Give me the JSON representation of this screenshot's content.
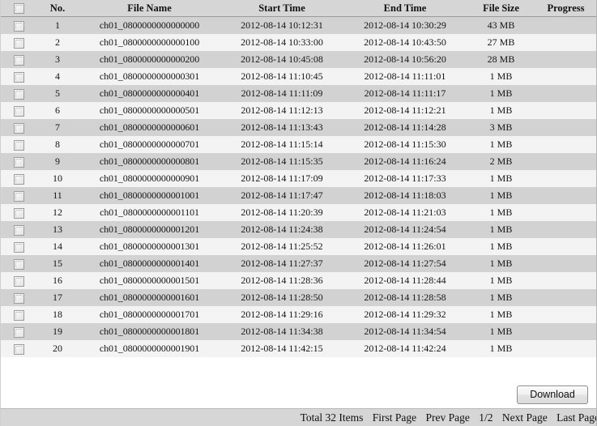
{
  "table": {
    "columns": [
      {
        "key": "select",
        "label": "",
        "name": "column-select"
      },
      {
        "key": "no",
        "label": "No.",
        "name": "column-no"
      },
      {
        "key": "name",
        "label": "File Name",
        "name": "column-file-name"
      },
      {
        "key": "start",
        "label": "Start Time",
        "name": "column-start-time"
      },
      {
        "key": "end",
        "label": "End Time",
        "name": "column-end-time"
      },
      {
        "key": "size",
        "label": "File Size",
        "name": "column-file-size"
      },
      {
        "key": "progress",
        "label": "Progress",
        "name": "column-progress"
      }
    ],
    "header_select_all": "select-all-checkbox",
    "rows": [
      {
        "no": "1",
        "name": "ch01_0800000000000000",
        "start": "2012-08-14 10:12:31",
        "end": "2012-08-14 10:30:29",
        "size": "43 MB",
        "progress": ""
      },
      {
        "no": "2",
        "name": "ch01_0800000000000100",
        "start": "2012-08-14 10:33:00",
        "end": "2012-08-14 10:43:50",
        "size": "27 MB",
        "progress": ""
      },
      {
        "no": "3",
        "name": "ch01_0800000000000200",
        "start": "2012-08-14 10:45:08",
        "end": "2012-08-14 10:56:20",
        "size": "28 MB",
        "progress": ""
      },
      {
        "no": "4",
        "name": "ch01_0800000000000301",
        "start": "2012-08-14 11:10:45",
        "end": "2012-08-14 11:11:01",
        "size": "1 MB",
        "progress": ""
      },
      {
        "no": "5",
        "name": "ch01_0800000000000401",
        "start": "2012-08-14 11:11:09",
        "end": "2012-08-14 11:11:17",
        "size": "1 MB",
        "progress": ""
      },
      {
        "no": "6",
        "name": "ch01_0800000000000501",
        "start": "2012-08-14 11:12:13",
        "end": "2012-08-14 11:12:21",
        "size": "1 MB",
        "progress": ""
      },
      {
        "no": "7",
        "name": "ch01_0800000000000601",
        "start": "2012-08-14 11:13:43",
        "end": "2012-08-14 11:14:28",
        "size": "3 MB",
        "progress": ""
      },
      {
        "no": "8",
        "name": "ch01_0800000000000701",
        "start": "2012-08-14 11:15:14",
        "end": "2012-08-14 11:15:30",
        "size": "1 MB",
        "progress": ""
      },
      {
        "no": "9",
        "name": "ch01_0800000000000801",
        "start": "2012-08-14 11:15:35",
        "end": "2012-08-14 11:16:24",
        "size": "2 MB",
        "progress": ""
      },
      {
        "no": "10",
        "name": "ch01_0800000000000901",
        "start": "2012-08-14 11:17:09",
        "end": "2012-08-14 11:17:33",
        "size": "1 MB",
        "progress": ""
      },
      {
        "no": "11",
        "name": "ch01_0800000000001001",
        "start": "2012-08-14 11:17:47",
        "end": "2012-08-14 11:18:03",
        "size": "1 MB",
        "progress": ""
      },
      {
        "no": "12",
        "name": "ch01_0800000000001101",
        "start": "2012-08-14 11:20:39",
        "end": "2012-08-14 11:21:03",
        "size": "1 MB",
        "progress": ""
      },
      {
        "no": "13",
        "name": "ch01_0800000000001201",
        "start": "2012-08-14 11:24:38",
        "end": "2012-08-14 11:24:54",
        "size": "1 MB",
        "progress": ""
      },
      {
        "no": "14",
        "name": "ch01_0800000000001301",
        "start": "2012-08-14 11:25:52",
        "end": "2012-08-14 11:26:01",
        "size": "1 MB",
        "progress": ""
      },
      {
        "no": "15",
        "name": "ch01_0800000000001401",
        "start": "2012-08-14 11:27:37",
        "end": "2012-08-14 11:27:54",
        "size": "1 MB",
        "progress": ""
      },
      {
        "no": "16",
        "name": "ch01_0800000000001501",
        "start": "2012-08-14 11:28:36",
        "end": "2012-08-14 11:28:44",
        "size": "1 MB",
        "progress": ""
      },
      {
        "no": "17",
        "name": "ch01_0800000000001601",
        "start": "2012-08-14 11:28:50",
        "end": "2012-08-14 11:28:58",
        "size": "1 MB",
        "progress": ""
      },
      {
        "no": "18",
        "name": "ch01_0800000000001701",
        "start": "2012-08-14 11:29:16",
        "end": "2012-08-14 11:29:32",
        "size": "1 MB",
        "progress": ""
      },
      {
        "no": "19",
        "name": "ch01_0800000000001801",
        "start": "2012-08-14 11:34:38",
        "end": "2012-08-14 11:34:54",
        "size": "1 MB",
        "progress": ""
      },
      {
        "no": "20",
        "name": "ch01_0800000000001901",
        "start": "2012-08-14 11:42:15",
        "end": "2012-08-14 11:42:24",
        "size": "1 MB",
        "progress": ""
      }
    ]
  },
  "actions": {
    "download_label": "Download"
  },
  "pager": {
    "total_label": "Total 32 Items",
    "first_page": "First Page",
    "prev_page": "Prev Page",
    "page_indicator": "1/2",
    "next_page": "Next Page",
    "last_page": "Last Page"
  },
  "colors": {
    "header_bg": "#d6d6d6",
    "row_odd_bg": "#d2d2d2",
    "row_even_bg": "#f3f3f3",
    "pager_bg": "#d6d6d6",
    "text": "#141414"
  }
}
